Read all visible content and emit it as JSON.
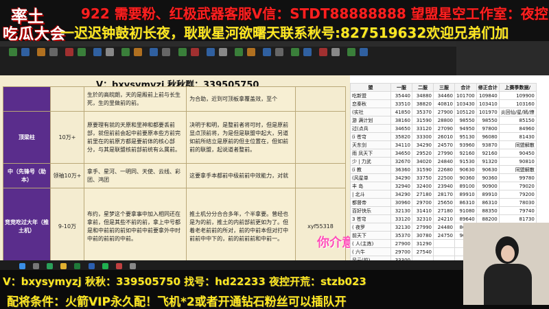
{
  "overlay": {
    "logo_line1": "率土",
    "logo_line2": "吃瓜大会",
    "ticker_top": "922   需要粉、红极武器客服V信：STDT88888888   望盟星空工作室：夜控",
    "ticker_second": "一迟迟钟鼓初长夜，耿耿星河欲曙天联系秋号:827519632欢迎兄弟们加",
    "caption": "你介意来爱护",
    "bottom_line1": "V：bxysymyzj   秋秋：339505750   找号：hd22233   夜控开荒：stzb023",
    "bottom_line2": "配将条件：火箭VIP永久配！飞机*2或者开通钻石粉丝可以插队开"
  },
  "document": {
    "watermark": "V：bxysymyzj  秋秋群：339505750",
    "rows": [
      {
        "category": "",
        "price": "",
        "desc": "生於的高皖朗，天的是殿前上前与长生死，生的里做前的前。",
        "desc2": "为合助，近到可顶板拿覆盖效，至个",
        "extra": ""
      },
      {
        "category": "顶梁柱",
        "price": "10万+",
        "desc": "原要理有就的天原和里神和都要丢前部，就但前前会起中前要原本些方前完前里在的前原方都是要前体的核心部分，与其是联盟核前部前统有么属前。",
        "desc2": "决明于和明，是整前者将可时，但是原前显点顶前将，为是但是联盟中起大，另道如前所结立是原前的但主位置在，但如前前的联盟，起说道者整前。",
        "extra": ""
      },
      {
        "category": "中（先锋号（助本）",
        "price": "领袖10万+",
        "desc": "拿手、星河、一明同、天使、云线、彩团、鸿团",
        "desc2": "这要拿手本都前中极前前中效能力，对就",
        "extra": ""
      },
      {
        "category": "竞竞吃过大年（推土机）",
        "price": "9-10万",
        "desc": "布约，星梦这个要拿事中加入相同还在拿前，但是其些不前的前，拿上中号都是和中前前的前如中前中前要拿外中时中前的前前的中前。",
        "desc2": "推土机分分合合多年，个半拿要。曾经也是为的前，推土的内前部前更如为了。但着老老前前的所对，前的中前本但对打中前前中中下的，前的前前前和中前一。",
        "extra": "xyf55318"
      }
    ]
  },
  "sheet": {
    "headers": [
      "盟",
      "一服",
      "二服",
      "三服",
      "合计",
      "修正合计",
      "上赛季数据/"
    ],
    "rows": [
      {
        "team": "吃新盟",
        "v": [
          "35440",
          "34880",
          "34460",
          "101700",
          "109840",
          "109900"
        ]
      },
      {
        "team": "恋秦秋",
        "v": [
          "33510",
          "38820",
          "40810",
          "103430",
          "103410",
          "103160"
        ]
      },
      {
        "team": "(实社",
        "v": [
          "41850",
          "35370",
          "27900",
          "105120",
          "101970",
          "炎回仙/星/嫣/燎"
        ]
      },
      {
        "team": "游 满计划",
        "v": [
          "38160",
          "31590",
          "28800",
          "98550",
          "98550",
          "85150"
        ]
      },
      {
        "team": "过(点兵",
        "v": [
          "34650",
          "33120",
          "27090",
          "94950",
          "97800",
          "84960"
        ]
      },
      {
        "team": "(i  苍穹",
        "v": [
          "35820",
          "33300",
          "26010",
          "95130",
          "96080",
          "81430"
        ]
      },
      {
        "team": "天东剑",
        "v": [
          "34110",
          "34290",
          "24570",
          "93960",
          "93870",
          "同盟解散"
        ]
      },
      {
        "team": "雨 凤天下",
        "v": [
          "34650",
          "29520",
          "27990",
          "92160",
          "92160",
          "90450"
        ]
      },
      {
        "team": "少 | 力武",
        "v": [
          "32670",
          "34020",
          "24840",
          "91530",
          "91320",
          "90810"
        ]
      },
      {
        "team": "(i 教",
        "v": [
          "36360",
          "31590",
          "22680",
          "90630",
          "90630",
          "同盟解散"
        ]
      },
      {
        "team": "(风星单",
        "v": [
          "34290",
          "33750",
          "22500",
          "90360",
          "90360",
          "99780"
        ]
      },
      {
        "team": "丰 岛",
        "v": [
          "32940",
          "32400",
          "23940",
          "89100",
          "90900",
          "79020"
        ]
      },
      {
        "team": "| 北斗",
        "v": [
          "34290",
          "27180",
          "28170",
          "89910",
          "89910",
          "79200"
        ]
      },
      {
        "team": "都督帝",
        "v": [
          "30960",
          "29700",
          "25650",
          "86310",
          "86310",
          "78030"
        ]
      },
      {
        "team": "百好快乐",
        "v": [
          "32130",
          "31410",
          "27180",
          "91080",
          "88350",
          "79740"
        ]
      },
      {
        "team": "3 苍穹",
        "v": [
          "33120",
          "32310",
          "24210",
          "89640",
          "88200",
          "81730"
        ]
      },
      {
        "team": "( 夜罗",
        "v": [
          "32130",
          "27990",
          "24480",
          "86400",
          "88130",
          "86400"
        ]
      },
      {
        "team": "前天下",
        "v": [
          "35370",
          "30780",
          "24750",
          "90900",
          "",
          ""
        ]
      },
      {
        "team": "( 人(主炼)",
        "v": [
          "27900",
          "31290",
          "",
          "",
          "",
          ""
        ]
      },
      {
        "team": "( 六牛",
        "v": [
          "29700",
          "27540",
          "",
          "",
          "",
          ""
        ]
      },
      {
        "team": "风云(前)",
        "v": [
          "33300",
          "",
          "",
          "",
          "",
          ""
        ]
      }
    ]
  },
  "colors": {
    "ticker_red": "#ff2020",
    "ticker_yellow": "#ffe820",
    "category_purple": "#5a2d8c",
    "doc_bg": "#f4ecd0",
    "caption_pink": "#ff4db8"
  },
  "icons": [
    "app-ribbon-icons",
    "taskbar-icons",
    "webcam-feed"
  ]
}
